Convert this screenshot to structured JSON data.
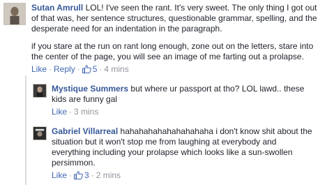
{
  "comments": [
    {
      "author": "Sutan Amrull",
      "paragraphs": [
        "LOL! I've seen the rant. It's very sweet. The only thing I got out of that was, her sentence structures, questionable grammar, spelling, and the desperate need for an indentation in the paragraph.",
        "if you stare at the run on rant long enough, zone out on the letters, stare into the center of the page, you will see an image of me farting out a prolapse."
      ],
      "like_label": "Like",
      "reply_label": "Reply",
      "like_count": "5",
      "time": "4 mins"
    },
    {
      "author": "Mystique Summers",
      "text": "but where ur passport at tho? LOL lawd.. these kids are funny gal",
      "like_label": "Like",
      "time": "3 mins"
    },
    {
      "author": "Gabriel Villarreal",
      "text": "hahahahahahahahahaha i don't know shit about the situation but it won't stop me from laughing at everybody and everything including your prolapse which looks like a sun-swollen persimmon.",
      "like_label": "Like",
      "like_count": "3",
      "time": "2 mins"
    }
  ],
  "colors": {
    "author": "#365899",
    "link": "#4267b2",
    "meta": "#90949c",
    "text": "#1d2129"
  },
  "icons": [
    "avatar-photo",
    "thumbs-up-icon"
  ]
}
